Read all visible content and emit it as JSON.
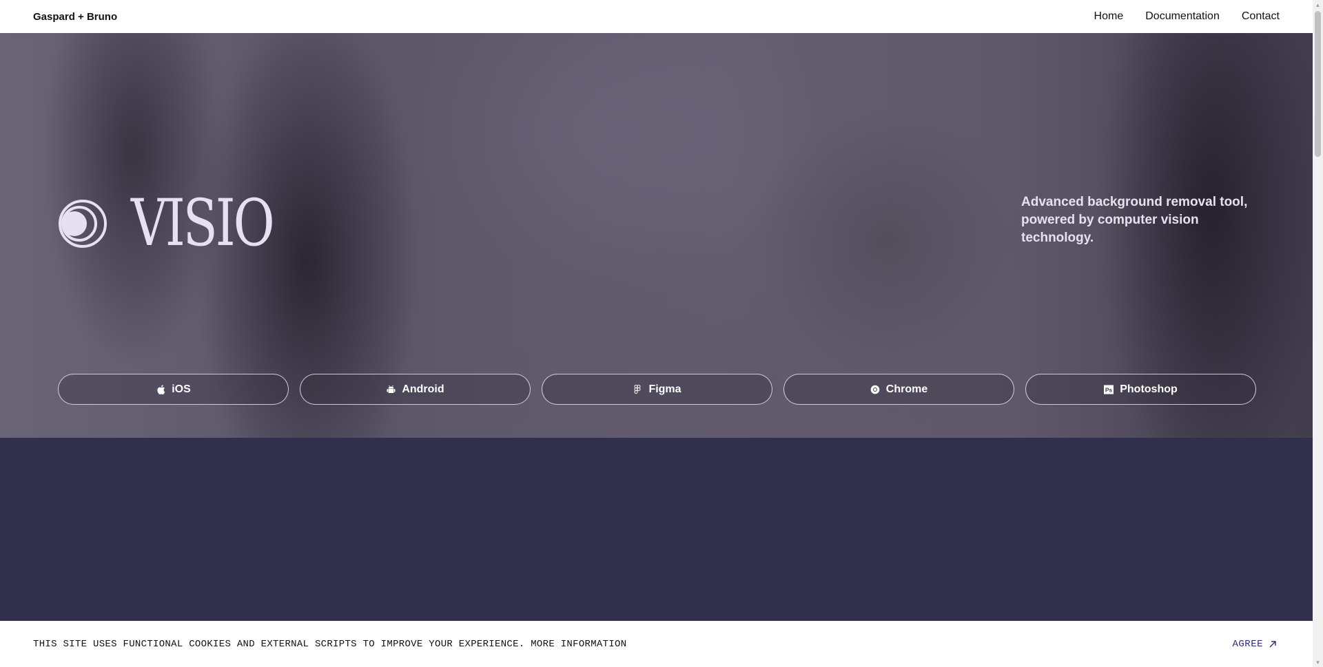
{
  "header": {
    "brand": "Gaspard + Bruno",
    "nav": [
      {
        "label": "Home"
      },
      {
        "label": "Documentation"
      },
      {
        "label": "Contact"
      }
    ]
  },
  "hero": {
    "product_name": "VISIO",
    "tagline": "Advanced background removal tool, powered by computer vision technology.",
    "platforms": [
      {
        "label": "iOS",
        "icon": "apple-icon"
      },
      {
        "label": "Android",
        "icon": "android-icon"
      },
      {
        "label": "Figma",
        "icon": "figma-icon"
      },
      {
        "label": "Chrome",
        "icon": "chrome-icon"
      },
      {
        "label": "Photoshop",
        "icon": "photoshop-icon"
      }
    ]
  },
  "cookie_banner": {
    "text": "THIS SITE USES FUNCTIONAL COOKIES AND EXTERNAL SCRIPTS TO IMPROVE YOUR EXPERIENCE.",
    "more_info": "MORE INFORMATION",
    "agree_label": "AGREE"
  },
  "colors": {
    "dark_section": "#31304c",
    "agree": "#2a2b7a",
    "logo": "#e6e1f2"
  }
}
